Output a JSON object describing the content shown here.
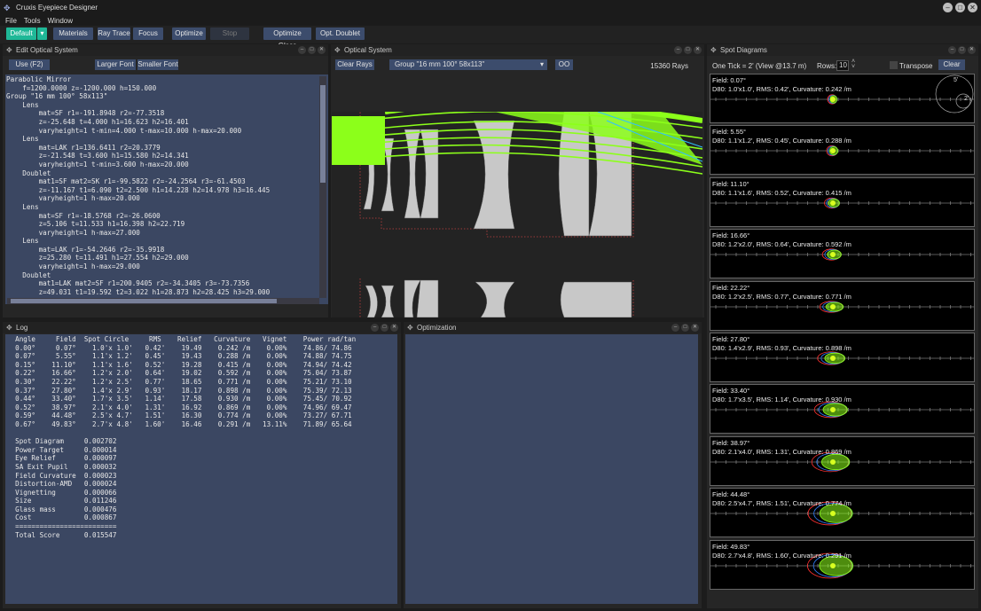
{
  "app": {
    "title": "Cruxis Eyepiece Designer"
  },
  "menu": [
    "File",
    "Tools",
    "Window"
  ],
  "toolbar": {
    "default": "Default",
    "materials": "Materials",
    "raytrace": "Ray Trace",
    "focus": "Focus",
    "optimize": "Optimize",
    "stop": "Stop",
    "optimize_glass": "Optimize Glass",
    "opt_doublet": "Opt. Doublet"
  },
  "edit": {
    "title": "Edit Optical System",
    "use": "Use (F2)",
    "larger": "Larger Font",
    "smaller": "Smaller Font",
    "lines": [
      "Parabolic Mirror",
      "    f=1200.0000 z=-1200.000 h=150.000",
      "Group \"16 mm 100° 58x113\"",
      "    Lens",
      "        mat=SF r1=-191.8948 r2=-77.3518",
      "        z=-25.648 t=4.000 h1=16.623 h2=16.401",
      "        varyheight=1 t-min=4.000 t-max=10.000 h-max=20.000",
      "    Lens",
      "        mat=LAK r1=136.6411 r2=20.3779",
      "        z=-21.548 t=3.600 h1=15.580 h2=14.341",
      "        varyheight=1 t-min=3.600 h-max=20.000",
      "    Doublet",
      "        mat1=SF mat2=SK r1=-99.5822 r2=-24.2564 r3=-61.4503",
      "        z=-11.167 t1=6.090 t2=2.500 h1=14.228 h2=14.978 h3=16.445",
      "        varyheight=1 h-max=20.000",
      "    Lens",
      "        mat=SF r1=-18.5768 r2=-26.0600",
      "        z=5.106 t=11.533 h1=16.398 h2=22.719",
      "        varyheight=1 h-max=27.000",
      "    Lens",
      "        mat=LAK r1=-54.2646 r2=-35.9918",
      "        z=25.280 t=11.491 h1=27.554 h2=29.000",
      "        varyheight=1 h-max=29.000",
      "    Doublet",
      "        mat1=LAK mat2=SF r1=200.9405 r2=-34.3405 r3=-73.7356",
      "        z=49.031 t1=19.592 t2=3.022 h1=28.873 h2=28.425 h3=29.000"
    ]
  },
  "optical": {
    "title": "Optical System",
    "clear_rays": "Clear Rays",
    "group_select": "Group \"16 mm 100° 58x113\"",
    "oo": "OO",
    "rays": "15360 Rays"
  },
  "log": {
    "title": "Log",
    "header": "  Angle     Field  Spot Circle     RMS    Relief   Curvature   Vignet    Power rad/tan",
    "rows": [
      "  0.00°     0.07°    1.0'x 1.0'   0.42'    19.49    0.242 /m    0.00%    74.86/ 74.86",
      "  0.07°     5.55°    1.1'x 1.2'   0.45'    19.43    0.288 /m    0.00%    74.88/ 74.75",
      "  0.15°    11.10°    1.1'x 1.6'   0.52'    19.28    0.415 /m    0.00%    74.94/ 74.42",
      "  0.22°    16.66°    1.2'x 2.0'   0.64'    19.02    0.592 /m    0.00%    75.04/ 73.87",
      "  0.30°    22.22°    1.2'x 2.5'   0.77'    18.65    0.771 /m    0.00%    75.21/ 73.10",
      "  0.37°    27.80°    1.4'x 2.9'   0.93'    18.17    0.898 /m    0.00%    75.39/ 72.13",
      "  0.44°    33.40°    1.7'x 3.5'   1.14'    17.58    0.930 /m    0.00%    75.45/ 70.92",
      "  0.52°    38.97°    2.1'x 4.0'   1.31'    16.92    0.869 /m    0.00%    74.96/ 69.47",
      "  0.59°    44.48°    2.5'x 4.7'   1.51'    16.30    0.774 /m    0.00%    73.27/ 67.71",
      "  0.67°    49.83°    2.7'x 4.8'   1.60'    16.46    0.291 /m   13.11%    71.89/ 65.64"
    ],
    "scores": [
      "  Spot Diagram     0.002702",
      "  Power Target     0.000014",
      "  Eye Relief       0.000097",
      "  SA Exit Pupil    0.000032",
      "  Field Curvature  0.000023",
      "  Distortion-AMD   0.000024",
      "  Vignetting       0.000066",
      "  Size             0.011246",
      "  Glass mass       0.000476",
      "  Cost             0.000867",
      "  =========================",
      "  Total Score      0.015547"
    ]
  },
  "optimization": {
    "title": "Optimization"
  },
  "spots": {
    "title": "Spot Diagrams",
    "tick": "One Tick = 2' (View @13.7 m)",
    "rows_label": "Rows:",
    "rows_value": "10",
    "transpose": "Transpose",
    "clear": "Clear",
    "scale_outer": "5'",
    "scale_inner": "2'",
    "items": [
      {
        "field": "Field: 0.07°",
        "info": "D80: 1.0'x1.0', RMS: 0.42', Curvature: 0.242 /m",
        "w": 1.0,
        "h": 1.0
      },
      {
        "field": "Field: 5.55°",
        "info": "D80: 1.1'x1.2', RMS: 0.45', Curvature: 0.288 /m",
        "w": 1.1,
        "h": 1.2
      },
      {
        "field": "Field: 11.10°",
        "info": "D80: 1.1'x1.6', RMS: 0.52', Curvature: 0.415 /m",
        "w": 1.1,
        "h": 1.6
      },
      {
        "field": "Field: 16.66°",
        "info": "D80: 1.2'x2.0', RMS: 0.64', Curvature: 0.592 /m",
        "w": 1.2,
        "h": 2.0
      },
      {
        "field": "Field: 22.22°",
        "info": "D80: 1.2'x2.5', RMS: 0.77', Curvature: 0.771 /m",
        "w": 1.2,
        "h": 2.5
      },
      {
        "field": "Field: 27.80°",
        "info": "D80: 1.4'x2.9', RMS: 0.93', Curvature: 0.898 /m",
        "w": 1.4,
        "h": 2.9
      },
      {
        "field": "Field: 33.40°",
        "info": "D80: 1.7'x3.5', RMS: 1.14', Curvature: 0.930 /m",
        "w": 1.7,
        "h": 3.5
      },
      {
        "field": "Field: 38.97°",
        "info": "D80: 2.1'x4.0', RMS: 1.31', Curvature: 0.869 /m",
        "w": 2.1,
        "h": 4.0
      },
      {
        "field": "Field: 44.48°",
        "info": "D80: 2.5'x4.7', RMS: 1.51', Curvature: 0.774 /m",
        "w": 2.5,
        "h": 4.7
      },
      {
        "field": "Field: 49.83°",
        "info": "D80: 2.7'x4.8', RMS: 1.60', Curvature: 0.291 /m",
        "w": 2.7,
        "h": 4.8
      }
    ]
  },
  "colors": {
    "ray": "#8cff1a",
    "accent": "#1fb897",
    "button": "#3c4c6c",
    "lens": "#c8c8c8",
    "text_panel": "#3b4762"
  }
}
